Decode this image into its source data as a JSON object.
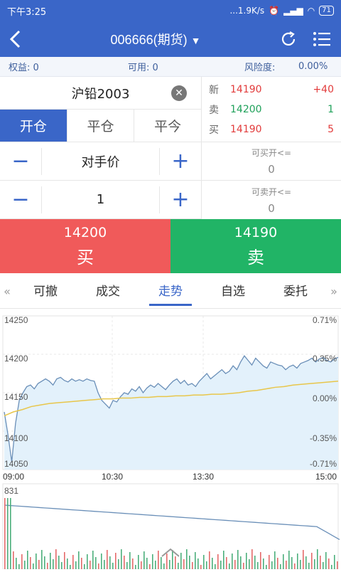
{
  "status": {
    "time": "下午3:25",
    "speed": "...1.9K/s",
    "battery": "71"
  },
  "header": {
    "title": "006666(期货)"
  },
  "account": {
    "equity": "权益: 0",
    "available": "可用: 0",
    "risk_label": "风险度:",
    "risk_value": "0.00%"
  },
  "order": {
    "symbol": "沪铅2003",
    "modes": [
      "开仓",
      "平仓",
      "平今"
    ],
    "price_type": "对手价",
    "quantity": "1"
  },
  "quote": {
    "rows": [
      {
        "label": "新",
        "price": "14190",
        "change": "+40"
      },
      {
        "label": "卖",
        "price": "14200",
        "change": "1"
      },
      {
        "label": "买",
        "price": "14190",
        "change": "5"
      }
    ],
    "can_buy_label": "可买开<=",
    "can_buy_value": "0",
    "can_sell_label": "可卖开<=",
    "can_sell_value": "0"
  },
  "trade": {
    "buy_price": "14200",
    "buy_label": "买",
    "sell_price": "14190",
    "sell_label": "卖"
  },
  "tabs": [
    "可撤",
    "成交",
    "走势",
    "自选",
    "委托"
  ],
  "colors": {
    "accent": "#3a66c8",
    "up": "#e23b3b",
    "down": "#1fa15a"
  },
  "chart_data": {
    "type": "line",
    "y_ticks": [
      "14250",
      "14200",
      "14150",
      "14100",
      "14050"
    ],
    "pct_ticks": [
      "0.71%",
      "0.35%",
      "0.00%",
      "-0.35%",
      "-0.71%"
    ],
    "x_ticks": [
      "09:00",
      "10:30",
      "13:30",
      "15:00"
    ],
    "ylim": [
      14050,
      14250
    ],
    "price_series": [
      14125,
      14095,
      14060,
      14110,
      14140,
      14150,
      14158,
      14160,
      14155,
      14162,
      14165,
      14168,
      14165,
      14160,
      14168,
      14170,
      14166,
      14164,
      14168,
      14165,
      14167,
      14165,
      14168,
      14166,
      14165,
      14150,
      14140,
      14135,
      14130,
      14140,
      14138,
      14145,
      14150,
      14148,
      14155,
      14152,
      14158,
      14150,
      14156,
      14160,
      14157,
      14162,
      14158,
      14154,
      14160,
      14165,
      14168,
      14162,
      14166,
      14160,
      14162,
      14158,
      14165,
      14170,
      14175,
      14168,
      14172,
      14176,
      14180,
      14175,
      14178,
      14185,
      14180,
      14190,
      14198,
      14192,
      14186,
      14195,
      14190,
      14185,
      14182,
      14190,
      14188,
      14186,
      14185,
      14180,
      14184,
      14186,
      14182,
      14188,
      14190,
      14192,
      14195,
      14190,
      14194,
      14196,
      14192,
      14190,
      14194,
      14196
    ],
    "avg_series": [
      14120,
      14125,
      14128,
      14132,
      14134,
      14136,
      14137,
      14138,
      14139,
      14140,
      14141,
      14142,
      14142,
      14143,
      14143,
      14144,
      14144,
      14145,
      14145,
      14146,
      14146,
      14147,
      14147,
      14148,
      14148,
      14149,
      14150,
      14152,
      14153,
      14155,
      14157,
      14158,
      14160,
      14161,
      14162,
      14163,
      14164,
      14165
    ],
    "volume_label": "831"
  }
}
